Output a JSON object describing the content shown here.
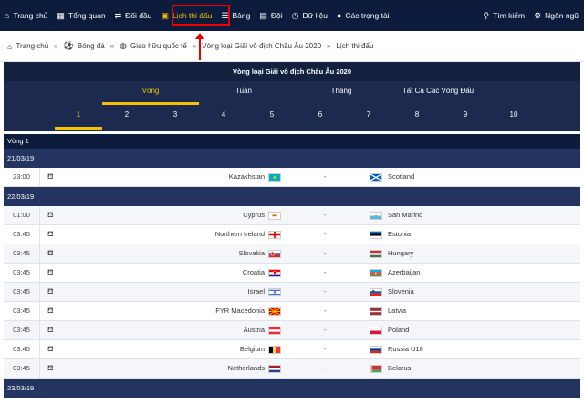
{
  "nav": {
    "items": [
      {
        "label": "Trang chủ",
        "icon": "home-icon",
        "glyph": "⌂"
      },
      {
        "label": "Tổng quan",
        "icon": "grid-icon",
        "glyph": "▦"
      },
      {
        "label": "Đối đầu",
        "icon": "versus-icon",
        "glyph": "⇄"
      },
      {
        "label": "Lịch thi đấu",
        "icon": "calendar-icon",
        "glyph": "▣",
        "active": true
      },
      {
        "label": "Bảng",
        "icon": "list-icon",
        "glyph": "☰"
      },
      {
        "label": "Đội",
        "icon": "team-icon",
        "glyph": "▤"
      },
      {
        "label": "Dữ liệu",
        "icon": "history-icon",
        "glyph": "◷"
      },
      {
        "label": "Các trọng tài",
        "icon": "user-icon",
        "glyph": "●"
      }
    ],
    "search_label": "Tìm kiếm",
    "search_glyph": "⚲",
    "language_label": "Ngôn ngữ",
    "language_glyph": "⚙"
  },
  "breadcrumb": [
    "Trang chủ",
    "Bóng đá",
    "Giao hữu quốc tế",
    "Vòng loại Giải vô địch Châu Âu 2020",
    "Lịch thi đấu"
  ],
  "panel": {
    "title": "Vòng loại Giải vô địch Châu Âu 2020",
    "filters": [
      "Vòng",
      "Tuần",
      "Tháng",
      "Tất Cả Các Vòng Đấu"
    ],
    "rounds": [
      "1",
      "2",
      "3",
      "4",
      "5",
      "6",
      "7",
      "8",
      "9",
      "10"
    ]
  },
  "round_label": "Vòng 1",
  "groups": [
    {
      "date": "21/03/19",
      "matches": [
        {
          "time": "23:00",
          "home": "Kazakhstan",
          "home_flag": "kazakhstan",
          "score": "-",
          "away": "Scotland",
          "away_flag": "scotland"
        }
      ]
    },
    {
      "date": "22/03/19",
      "matches": [
        {
          "time": "01:00",
          "home": "Cyprus",
          "home_flag": "cyprus",
          "score": "-",
          "away": "San Marino",
          "away_flag": "sanmarino"
        },
        {
          "time": "03:45",
          "home": "Northern Ireland",
          "home_flag": "nireland",
          "score": "-",
          "away": "Estonia",
          "away_flag": "estonia"
        },
        {
          "time": "03:45",
          "home": "Slovakia",
          "home_flag": "slovakia",
          "score": "-",
          "away": "Hungary",
          "away_flag": "hungary"
        },
        {
          "time": "03:45",
          "home": "Croatia",
          "home_flag": "croatia",
          "score": "-",
          "away": "Azerbaijan",
          "away_flag": "azerbaijan"
        },
        {
          "time": "03:45",
          "home": "Israel",
          "home_flag": "israel",
          "score": "-",
          "away": "Slovenia",
          "away_flag": "slovenia"
        },
        {
          "time": "03:45",
          "home": "FYR Macedonia",
          "home_flag": "macedonia",
          "score": "-",
          "away": "Latvia",
          "away_flag": "latvia"
        },
        {
          "time": "03:45",
          "home": "Austria",
          "home_flag": "austria",
          "score": "-",
          "away": "Poland",
          "away_flag": "poland"
        },
        {
          "time": "03:45",
          "home": "Belgium",
          "home_flag": "belgium",
          "score": "-",
          "away": "Russia U18",
          "away_flag": "russia"
        },
        {
          "time": "03:45",
          "home": "Netherlands",
          "home_flag": "netherlands",
          "score": "-",
          "away": "Belarus",
          "away_flag": "belarus"
        }
      ]
    },
    {
      "date": "23/03/19",
      "matches": []
    }
  ],
  "colors": {
    "nav_bg": "#0d1b3d",
    "accent": "#f2c200",
    "highlight": "#ee0000",
    "date_row": "#22345f"
  }
}
